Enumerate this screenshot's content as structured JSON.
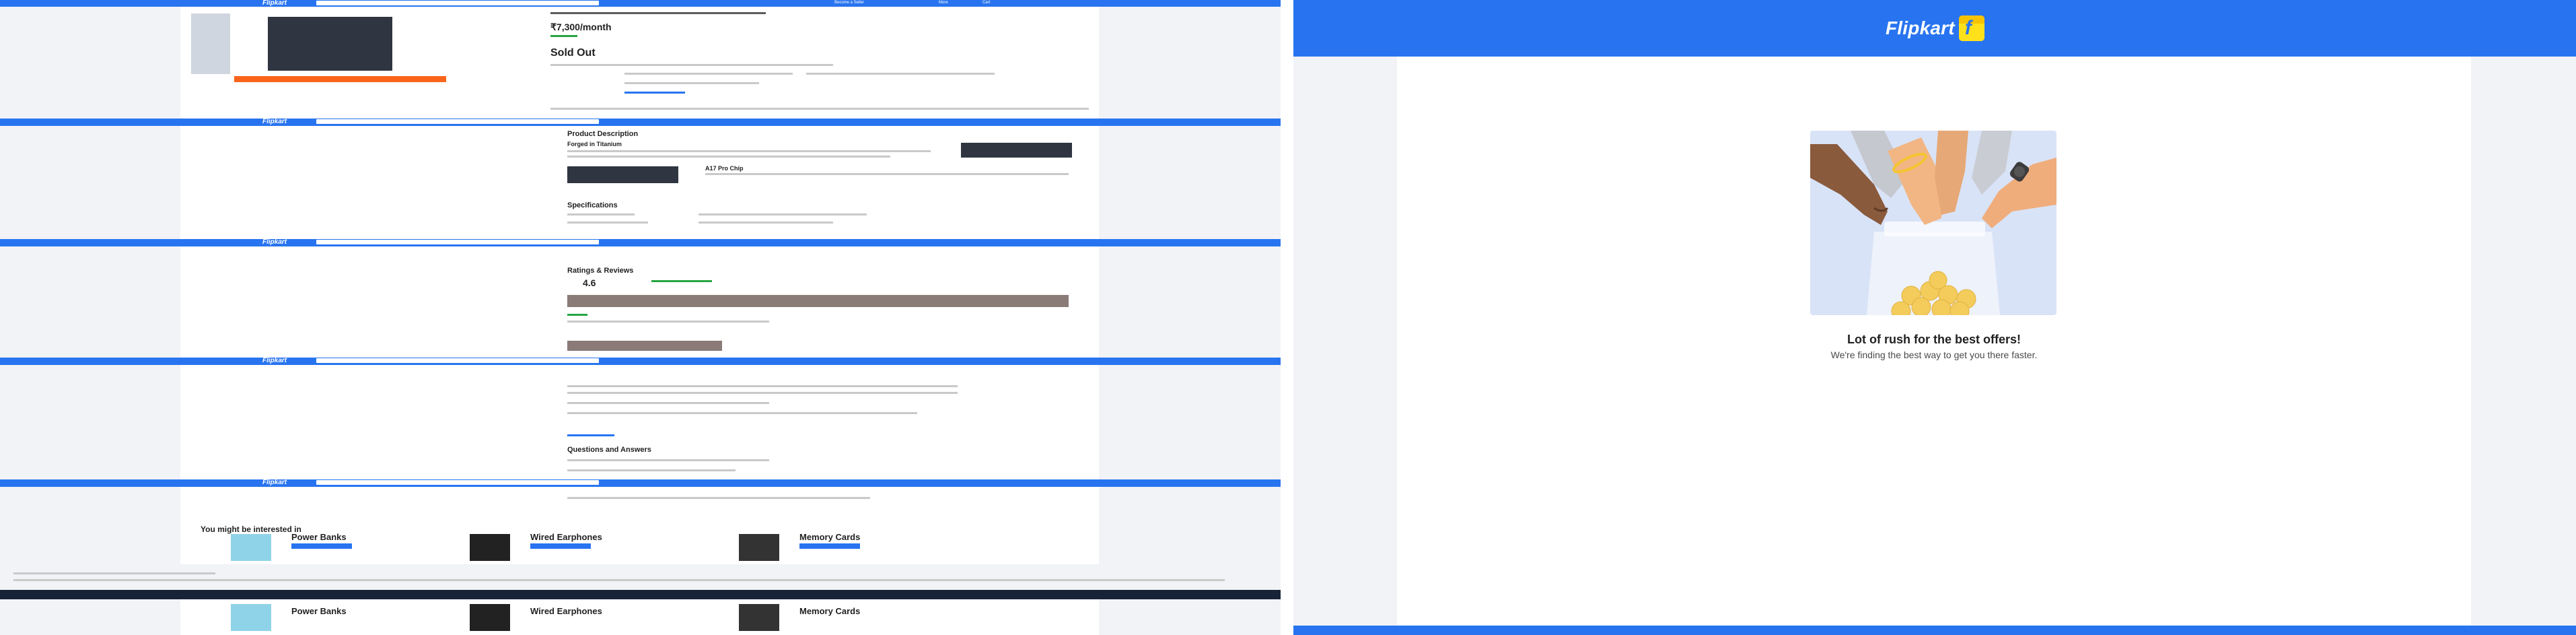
{
  "brand": {
    "name": "Flipkart",
    "accent": "#2874f0",
    "yellow": "#ffe11b"
  },
  "rush": {
    "title": "Lot of rush for the best offers!",
    "subtitle": "We're finding the best way to get you there faster."
  },
  "background_capture": {
    "header_logo": "Flipkart",
    "nav_items": [
      "Become a Seller",
      "More",
      "Cart"
    ],
    "price": "₹7,300/month",
    "status": "Sold Out",
    "sections": [
      "Product Description",
      "Specifications",
      "Ratings & Reviews",
      "Questions and Answers"
    ],
    "rating": "4.6",
    "feature_heading": "Forged in Titanium",
    "chip_heading": "A17 Pro Chip",
    "reco_title": "You might be interested in",
    "reco_items": [
      "Power Banks",
      "Wired Earphones",
      "Memory Cards"
    ]
  }
}
